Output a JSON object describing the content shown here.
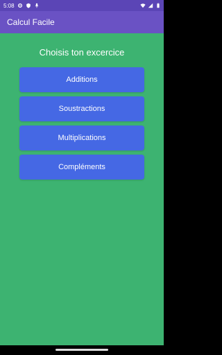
{
  "status_bar": {
    "time": "5:08",
    "icons": [
      "settings-icon",
      "shield-icon",
      "mic-icon",
      "wifi-icon",
      "signal-icon",
      "battery-icon"
    ]
  },
  "app_bar": {
    "title": "Calcul Facile"
  },
  "main": {
    "heading": "Choisis ton excercice",
    "buttons": [
      {
        "label": "Additions"
      },
      {
        "label": "Soustractions"
      },
      {
        "label": "Multiplications"
      },
      {
        "label": "Compléments"
      }
    ]
  },
  "colors": {
    "status_bar": "#5b45b6",
    "app_bar": "#6a52c4",
    "background": "#3db371",
    "button": "#4568e4",
    "text": "#ffffff"
  }
}
